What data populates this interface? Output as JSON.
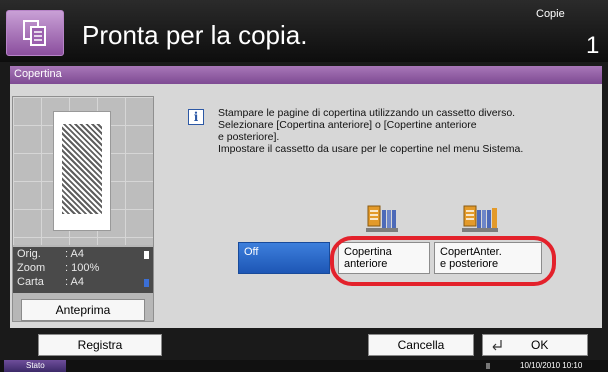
{
  "header": {
    "title": "Pronta per la copia.",
    "copies_label": "Copie",
    "copies_count": "1"
  },
  "section": {
    "title": "Copertina"
  },
  "preview": {
    "rows": [
      {
        "key": "Orig.",
        "value": ": A4"
      },
      {
        "key": "Zoom",
        "value": ": 100%"
      },
      {
        "key": "Carta",
        "value": ": A4"
      }
    ],
    "button_label": "Anteprima"
  },
  "message": {
    "lines": [
      "Stampare le pagine di copertina utilizzando un cassetto diverso.",
      "Selezionare [Copertina anteriore] o [Copertine anteriore",
      "e posteriore].",
      "Impostare il cassetto da usare per le copertine nel menu Sistema."
    ]
  },
  "options": {
    "off": "Off",
    "front_line1": "Copertina",
    "front_line2": "anteriore",
    "both_line1": "CopertAnter.",
    "both_line2": "e posteriore",
    "selected": "Off"
  },
  "footer": {
    "registra": "Registra",
    "cancella": "Cancella",
    "ok": "OK"
  },
  "status": {
    "label": "Stato",
    "datetime": "10/10/2010  10:10"
  },
  "colors": {
    "accent_purple": "#8b4f9e",
    "selected_blue": "#1d56b5",
    "highlight_red": "#e3212b"
  },
  "icons": {
    "header": "copy-document-icon",
    "info": "info-icon",
    "tray": "paper-tray-icon",
    "enter": "enter-icon"
  }
}
